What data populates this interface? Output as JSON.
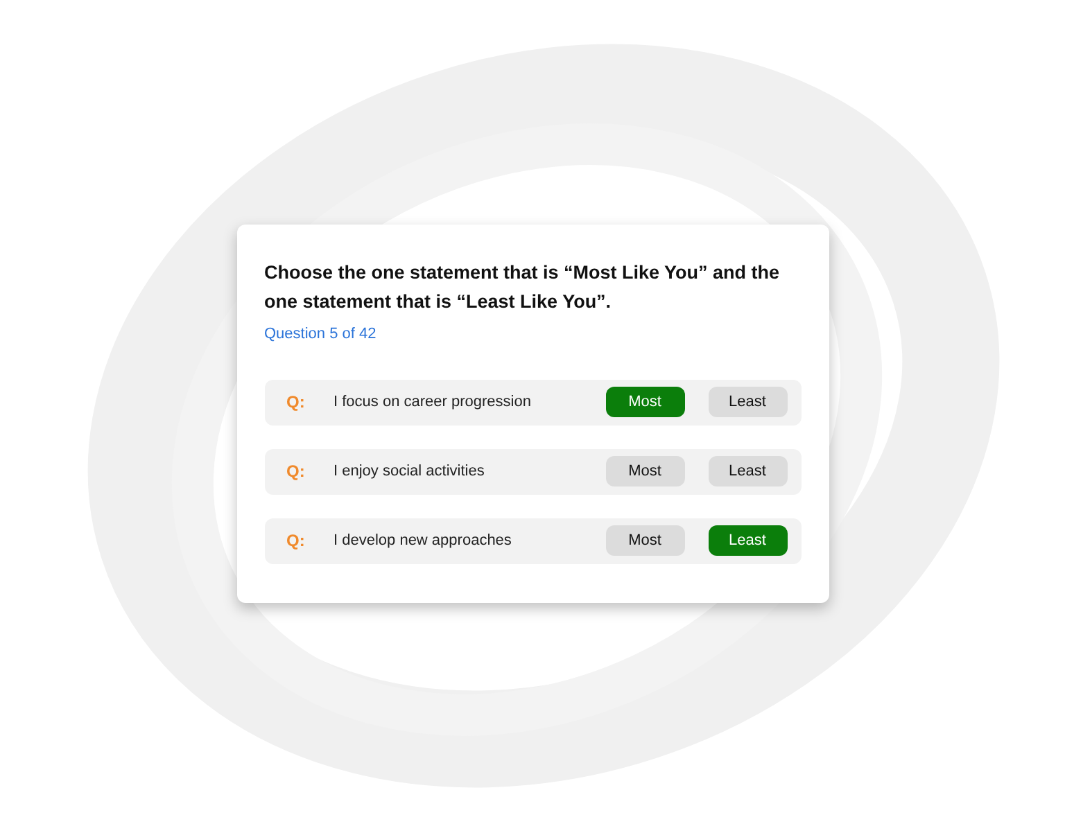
{
  "card": {
    "title": "Choose the one statement that is “Most Like You” and the one statement that is “Least Like You”.",
    "progress": "Question 5 of 42",
    "statements": [
      {
        "prefix": "Q:",
        "text": "I focus on career progression",
        "options": [
          {
            "label": "Most",
            "selected": true
          },
          {
            "label": "Least",
            "selected": false
          }
        ]
      },
      {
        "prefix": "Q:",
        "text": "I enjoy social activities",
        "options": [
          {
            "label": "Most",
            "selected": false
          },
          {
            "label": "Least",
            "selected": false
          }
        ]
      },
      {
        "prefix": "Q:",
        "text": "I develop new approaches",
        "options": [
          {
            "label": "Most",
            "selected": false
          },
          {
            "label": "Least",
            "selected": true
          }
        ]
      }
    ]
  }
}
